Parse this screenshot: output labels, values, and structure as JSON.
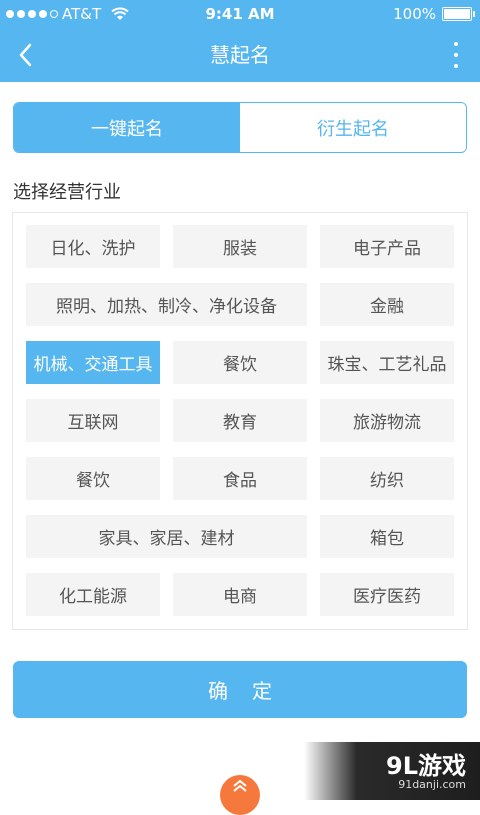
{
  "status_bar": {
    "carrier": "AT&T",
    "time": "9:41 AM",
    "battery": "100%",
    "battery_level": 1.0,
    "signal_bars": 4
  },
  "navbar": {
    "title": "慧起名"
  },
  "tabs": [
    {
      "label": "一键起名",
      "active": true
    },
    {
      "label": "衍生起名",
      "active": false
    }
  ],
  "industry": {
    "section_title": "选择经营行业",
    "items": [
      "日化、洗护",
      "服装",
      "电子产品",
      "照明、加热、制冷、净化设备",
      "金融",
      "机械、交通工具",
      "餐饮",
      "珠宝、工艺礼品",
      "互联网",
      "教育",
      "旅游物流",
      "餐饮",
      "食品",
      "纺织",
      "家具、家居、建材",
      "箱包",
      "化工能源",
      "电商",
      "医疗医药"
    ],
    "selected": "机械、交通工具"
  },
  "confirm": {
    "label": "确定"
  },
  "watermark": {
    "logo": "9L游戏",
    "url": "91danji.com"
  },
  "colors": {
    "accent": "#56b6ef",
    "chip_bg": "#f4f4f4",
    "handle": "#f5793d"
  }
}
